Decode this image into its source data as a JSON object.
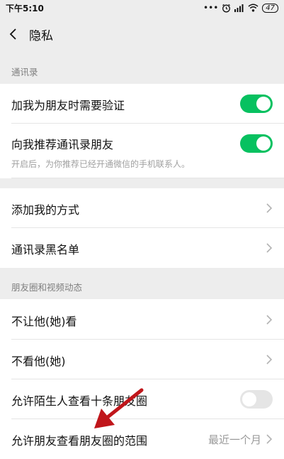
{
  "status_bar": {
    "time": "下午5:10",
    "dots": "•••",
    "battery": "47"
  },
  "nav": {
    "title": "隐私"
  },
  "sections": [
    {
      "header": "通讯录",
      "rows": [
        {
          "label": "加我为朋友时需要验证",
          "control": "toggle",
          "on": true
        },
        {
          "label": "向我推荐通讯录朋友",
          "control": "toggle",
          "on": true,
          "sub": "开启后，为你推荐已经开通微信的手机联系人。"
        },
        {
          "label": "添加我的方式",
          "control": "chevron"
        },
        {
          "label": "通讯录黑名单",
          "control": "chevron"
        }
      ]
    },
    {
      "header": "朋友圈和视频动态",
      "rows": [
        {
          "label": "不让他(她)看",
          "control": "chevron"
        },
        {
          "label": "不看他(她)",
          "control": "chevron"
        },
        {
          "label": "允许陌生人查看十条朋友圈",
          "control": "toggle",
          "on": false
        },
        {
          "label": "允许朋友查看朋友圈的范围",
          "control": "chevron",
          "value": "最近一个月"
        }
      ]
    }
  ],
  "colors": {
    "accent": "#07c160",
    "annotation_arrow": "#c0161b",
    "background": "#ededed"
  }
}
